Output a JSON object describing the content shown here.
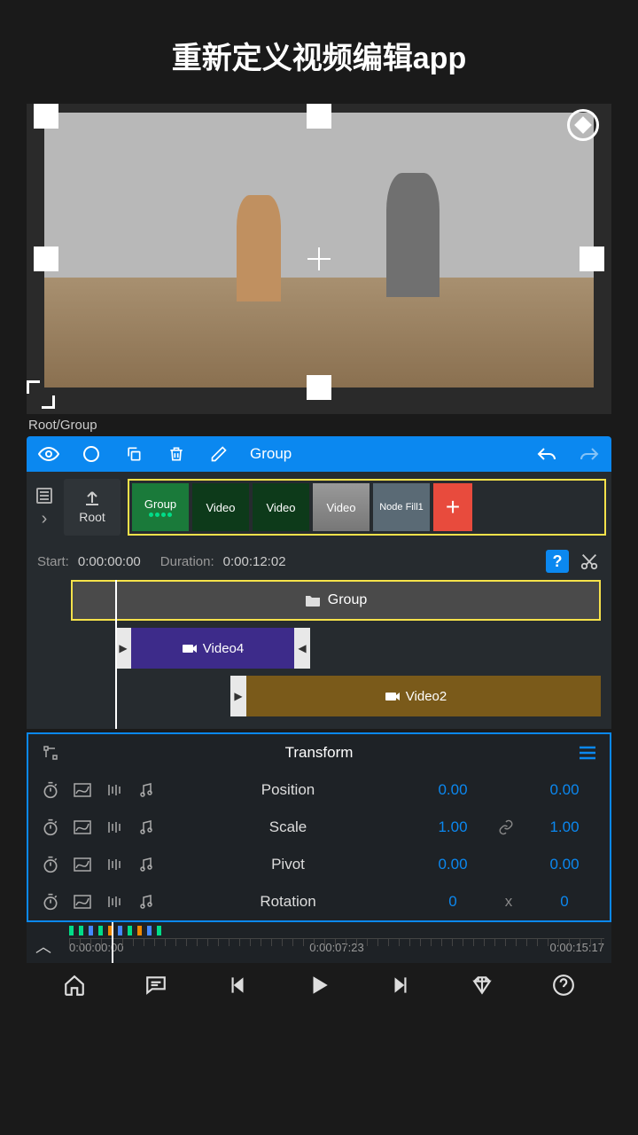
{
  "page_title": "重新定义视频编辑app",
  "breadcrumb": "Root/Group",
  "toolbar": {
    "active_label": "Group"
  },
  "root": {
    "label": "Root"
  },
  "clips": {
    "group": "Group",
    "video_a": "Video",
    "video_b": "Video",
    "video_c": "Video",
    "fill": "Node Fill1",
    "add": "+"
  },
  "timing": {
    "start_label": "Start:",
    "start_value": "0:00:00:00",
    "duration_label": "Duration:",
    "duration_value": "0:00:12:02"
  },
  "tracks": {
    "group": "Group",
    "video4": "Video4",
    "video2": "Video2"
  },
  "transform": {
    "title": "Transform",
    "rows": [
      {
        "label": "Position",
        "a": "0.00",
        "sep": "",
        "b": "0.00"
      },
      {
        "label": "Scale",
        "a": "1.00",
        "sep": "link",
        "b": "1.00"
      },
      {
        "label": "Pivot",
        "a": "0.00",
        "sep": "",
        "b": "0.00"
      },
      {
        "label": "Rotation",
        "a": "0",
        "sep": "x",
        "b": "0"
      }
    ]
  },
  "mini_timeline": {
    "t0": "0:00:00:00",
    "t1": "0:00:07:23",
    "t2": "0:00:15:17"
  }
}
